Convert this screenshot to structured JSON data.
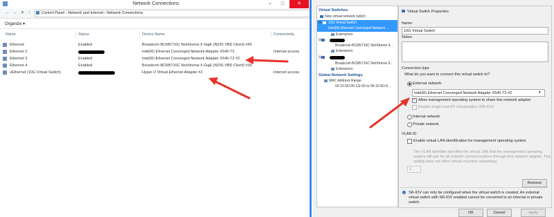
{
  "nc": {
    "title": "Network Connections",
    "breadcrumb": "Control Panel  ›  Network and Internet  ›  Network Connections",
    "organize": "Organize ▾",
    "columns": {
      "name": "Name",
      "status": "Status",
      "device": "Device Name",
      "conn": "Connectivity"
    },
    "rows": [
      {
        "name": "Ethernet",
        "status": "Enabled",
        "device": "Broadcom BCM5716C NetXtreme II GigE (NDIS VBD Client) #40",
        "conn": ""
      },
      {
        "name": "Ethernet 2",
        "status": "",
        "device": "Intel(R) Ethernet Converged Network Adapter X540-T2",
        "conn": "Internet access"
      },
      {
        "name": "Ethernet 3",
        "status": "Enabled",
        "device": "Intel(R) Ethernet Converged Network Adapter X540-T2 #2",
        "conn": ""
      },
      {
        "name": "Ethernet 4",
        "status": "Enabled",
        "device": "Broadcom BCM5716C NetXtreme II GigE (NDIS VBD Client) #39",
        "conn": ""
      },
      {
        "name": "vEthernet (10G Virtual Switch)",
        "status": "",
        "device": "Hyper-V Virtual Ethernet Adapter #2",
        "conn": "Internet access"
      }
    ]
  },
  "vsm": {
    "tree": {
      "section1": "Virtual Switches",
      "new_switch": "New virtual network switch",
      "sw1_name": "10G Virtual Switch",
      "sw1_adapter": "Intel(R) Ethernet Converged Network ...",
      "ext": "Extensions",
      "sw2_adapter": "Broadcom BCM5716C NetXtreme II...",
      "sw3_adapter": "Broadcom BCM5716C NetXtreme II...",
      "section2": "Global Network Settings",
      "mac": "MAC Address Range",
      "mac_value": "00-15-5D-00-CE-00 to 00-15-5D-0..."
    },
    "props": {
      "header": "Virtual Switch Properties",
      "name_label": "Name:",
      "name_value": "10G Virtual Switch",
      "notes_label": "Notes:",
      "conn_type": "Connection type",
      "conn_question": "What do you want to connect this virtual switch to?",
      "external": "External network:",
      "adapter_selected": "Intel(R) Ethernet Converged Network Adapter X540-T2 #2",
      "allow_mgmt": "Allow management operating system to share this network adapter",
      "sriov": "Enable single-root I/O virtualization (SR-IOV)",
      "internal": "Internal network",
      "private": "Private network",
      "vlan_header": "VLAN ID",
      "vlan_enable": "Enable virtual LAN identification for management operating system",
      "vlan_desc1": "The VLAN identifier specifies the virtual LAN that the management operating",
      "vlan_desc2": "system will use for all network communications through this network adapter. This",
      "vlan_desc3": "setting does not affect virtual machine networking.",
      "vlan_value": "2",
      "remove": "Remove",
      "info1": "SR-IOV can only be configured when the virtual switch is created. An external",
      "info2": "virtual switch with SR-IOV enabled cannot be converted to an internal or private",
      "info3": "switch.",
      "ok": "OK",
      "cancel": "Cancel",
      "apply": "Apply"
    }
  },
  "colors": {
    "accent": "#3399ff",
    "arrow": "#e8322a",
    "title_blue": "#1d4e95"
  }
}
